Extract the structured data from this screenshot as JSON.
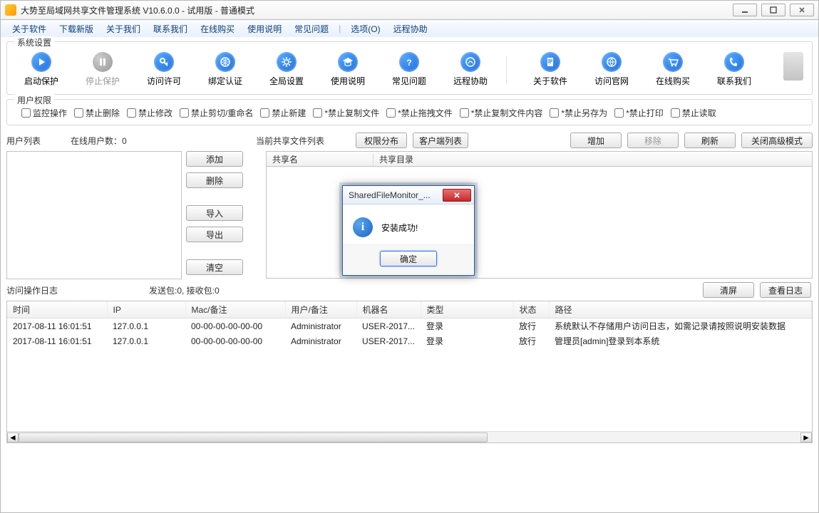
{
  "title": "大势至局域网共享文件管理系统 V10.6.0.0 - 试用版 - 普通模式",
  "menu": [
    "关于软件",
    "下载新版",
    "关于我们",
    "联系我们",
    "在线购买",
    "使用说明",
    "常见问题"
  ],
  "menu2": [
    "选项(O)",
    "远程协助"
  ],
  "group_system": "系统设置",
  "toolbar": [
    {
      "label": "启动保护",
      "icon": "play"
    },
    {
      "label": "停止保护",
      "icon": "pause",
      "disabled": true
    },
    {
      "label": "访问许可",
      "icon": "key"
    },
    {
      "label": "绑定认证",
      "icon": "globe"
    },
    {
      "label": "全局设置",
      "icon": "gear"
    },
    {
      "label": "使用说明",
      "icon": "grad"
    },
    {
      "label": "常见问题",
      "icon": "help"
    },
    {
      "label": "远程协助",
      "icon": "remote"
    }
  ],
  "toolbar2": [
    {
      "label": "关于软件",
      "icon": "doc"
    },
    {
      "label": "访问官网",
      "icon": "ie"
    },
    {
      "label": "在线购买",
      "icon": "cart"
    },
    {
      "label": "联系我们",
      "icon": "phone"
    }
  ],
  "group_perm": "用户权限",
  "perms": [
    "监控操作",
    "禁止删除",
    "禁止修改",
    "禁止剪切/重命名",
    "禁止新建",
    "*禁止复制文件",
    "*禁止拖拽文件",
    "*禁止复制文件内容",
    "*禁止另存为",
    "*禁止打印",
    "禁止读取"
  ],
  "labels": {
    "userlist": "用户列表",
    "online_prefix": "在线用户数：",
    "online_count": "0",
    "sharelist": "当前共享文件列表",
    "perm_dist": "权限分布",
    "client_list": "客户端列表",
    "add": "增加",
    "remove": "移除",
    "refresh": "刷新",
    "close_adv": "关闭高级模式",
    "side_add": "添加",
    "side_del": "删除",
    "side_import": "导入",
    "side_export": "导出",
    "side_clear": "清空",
    "share_name": "共享名",
    "share_dir": "共享目录",
    "log_title": "访问操作日志",
    "packets": "发送包:0, 接收包:0",
    "clear_screen": "清屏",
    "view_log": "查看日志"
  },
  "log_cols": [
    "时间",
    "IP",
    "Mac/备注",
    "用户/备注",
    "机器名",
    "类型",
    "状态",
    "路径"
  ],
  "log_rows": [
    {
      "time": "2017-08-11 16:01:51",
      "ip": "127.0.0.1",
      "mac": "00-00-00-00-00-00",
      "user": "Administrator",
      "host": "USER-2017...",
      "type": "登录",
      "status": "放行",
      "path": "系统默认不存储用户访问日志，如需记录请按照说明安装数据"
    },
    {
      "time": "2017-08-11 16:01:51",
      "ip": "127.0.0.1",
      "mac": "00-00-00-00-00-00",
      "user": "Administrator",
      "host": "USER-2017...",
      "type": "登录",
      "status": "放行",
      "path": "管理员[admin]登录到本系统"
    }
  ],
  "modal": {
    "title": "SharedFileMonitor_...",
    "message": "安装成功!",
    "ok": "确定"
  }
}
